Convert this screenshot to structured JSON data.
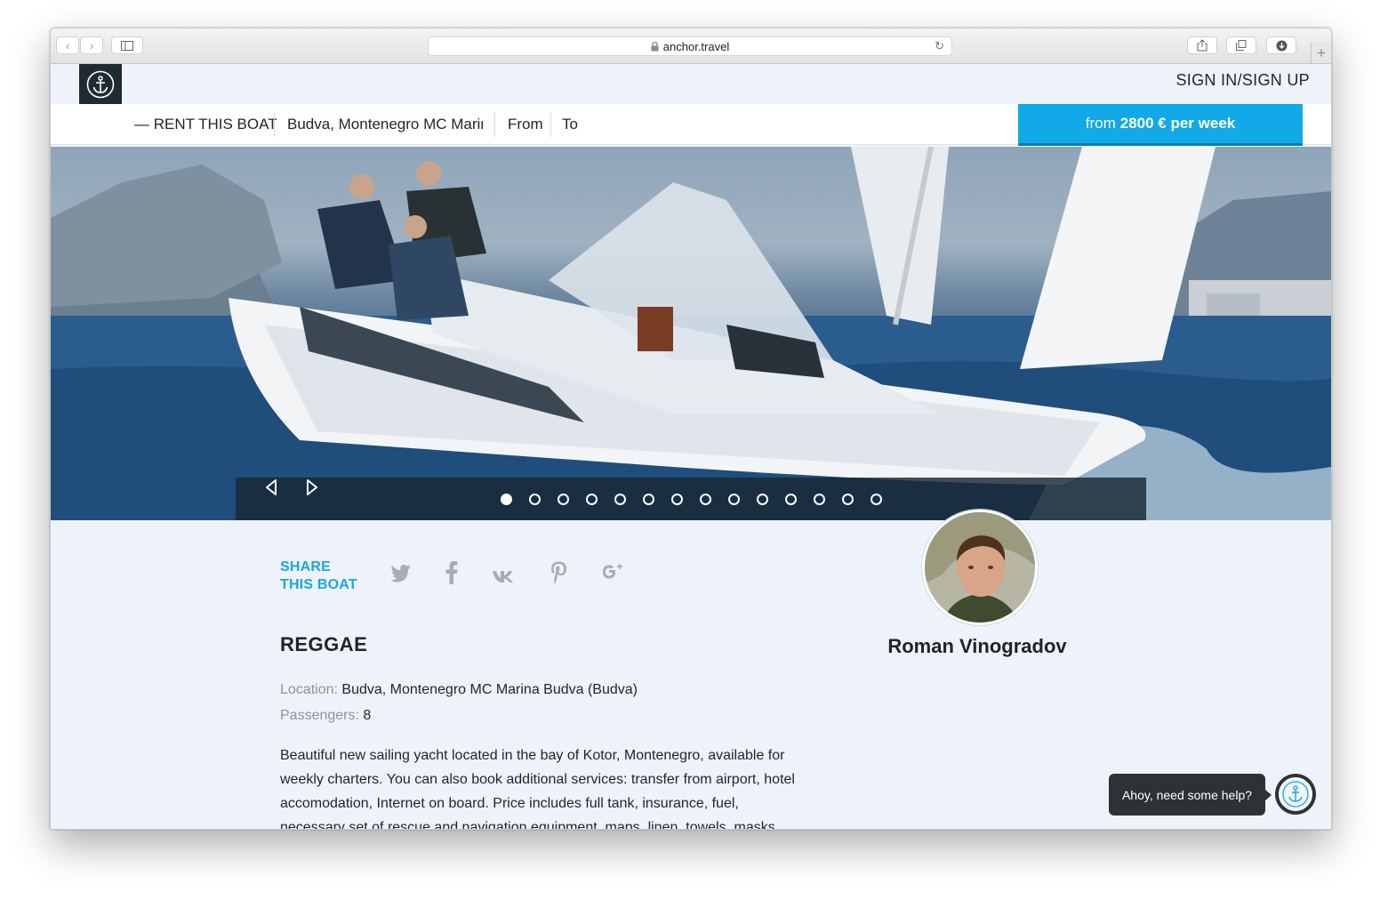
{
  "browser": {
    "url": "anchor.travel",
    "new_tab": "+"
  },
  "header": {
    "signin_label": "SIGN IN/SIGN UP"
  },
  "booking": {
    "rent_label": "— RENT THIS BOAT",
    "location_value": "Budva, Montenegro MC Marina Budva",
    "from_label": "From",
    "to_label": "To",
    "price_prefix": "from",
    "price_value": "2800 € per week"
  },
  "gallery": {
    "slide_count": 14,
    "active_slide": 1
  },
  "share": {
    "line1": "SHARE",
    "line2": "THIS BOAT",
    "networks": [
      "twitter-icon",
      "facebook-icon",
      "vk-icon",
      "pinterest-icon",
      "google-plus-icon"
    ]
  },
  "boat": {
    "name": "REGGAE",
    "location_label": "Location:",
    "location_value": "Budva, Montenegro MC Marina Budva (Budva)",
    "passengers_label": "Passengers:",
    "passengers_value": "8",
    "description": "Beautiful new sailing yacht located in the bay of Kotor, Montenegro, available for weekly charters. You can also book additional services: transfer from airport, hotel accomodation, Internet on board. Price includes full tank, insurance, fuel, necessary set of rescue and navigation equipment, maps, linen, towels, masks"
  },
  "owner": {
    "name": "Roman Vinogradov"
  },
  "help": {
    "text": "Ahoy, need some help?"
  },
  "colors": {
    "accent": "#11a9e8",
    "dark": "#1f2b33",
    "page_bg": "#eef3fb"
  }
}
